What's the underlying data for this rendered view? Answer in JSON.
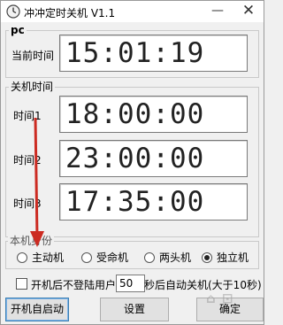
{
  "titlebar": {
    "title": "冲冲定时关机 V1.1",
    "minimize": "—",
    "close": "✕"
  },
  "pc_group": {
    "label": "pc",
    "current_time_label": "当前时间",
    "current_time": "15:01:19"
  },
  "shutdown_group": {
    "label": "关机时间",
    "rows": [
      {
        "label": "时间1",
        "value": "18:00:00"
      },
      {
        "label": "时间2",
        "value": "23:00:00"
      },
      {
        "label": "时间3",
        "value": "17:35:00"
      }
    ]
  },
  "identity_group": {
    "label": "本机身份",
    "options": [
      {
        "label": "主动机",
        "checked": false
      },
      {
        "label": "受命机",
        "checked": false
      },
      {
        "label": "两头机",
        "checked": false
      },
      {
        "label": "独立机",
        "checked": true
      }
    ]
  },
  "auto_shutdown": {
    "checked": false,
    "prefix": "开机后不登陆用户",
    "value": "50",
    "suffix": "秒后自动关机(大于10秒)"
  },
  "buttons": {
    "autostart": "开机自启动",
    "settings": "设置",
    "confirm": "确定"
  },
  "colors": {
    "annotation_arrow": "#cc2b22"
  }
}
